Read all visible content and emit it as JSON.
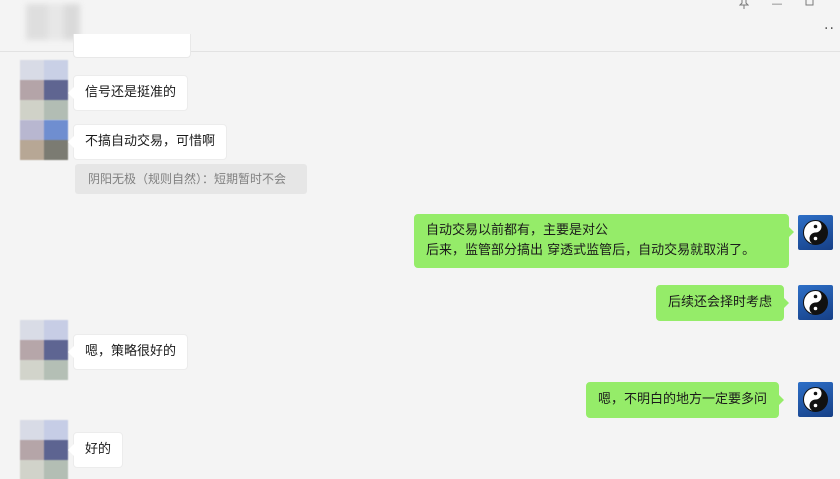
{
  "window": {
    "pin_icon": "pin-icon",
    "minimize_label": "—",
    "maximize_icon": "maximize-icon",
    "more_label": "··"
  },
  "messages": [
    {
      "side": "left",
      "text": "信号还是挺准的"
    },
    {
      "side": "left",
      "text": "不搞自动交易，可惜啊"
    },
    {
      "side": "quote",
      "text": "阴阳无极（规则自然）：短期暂时不会"
    },
    {
      "side": "right",
      "lines": [
        "自动交易以前都有，主要是对公",
        "后来，监管部分搞出 穿透式监管后，自动交易就取消了。"
      ]
    },
    {
      "side": "right",
      "text": "后续还会择时考虑"
    },
    {
      "side": "left",
      "text": "嗯，策略很好的"
    },
    {
      "side": "right",
      "text": "嗯，不明白的地方一定要多问"
    },
    {
      "side": "left",
      "text": "好的"
    }
  ],
  "colors": {
    "background": "#f4f4f4",
    "bubble_self": "#95ec69",
    "bubble_other": "#ffffff",
    "quote_bg": "#e6e6e6"
  }
}
